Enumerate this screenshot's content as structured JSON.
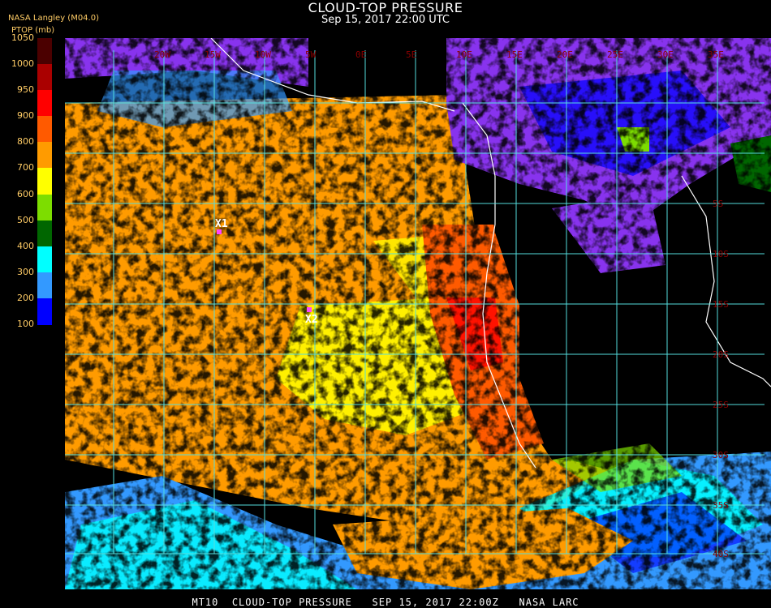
{
  "header": {
    "title": "CLOUD-TOP PRESSURE",
    "subtitle": "Sep 15, 2017 22:00 UTC",
    "source": "NASA Langley (M04.0)",
    "unit": "PTOP (mb)"
  },
  "legend": {
    "ticks": [
      "1050",
      "1000",
      "950",
      "900",
      "800",
      "700",
      "600",
      "500",
      "400",
      "300",
      "200",
      "100"
    ],
    "colors": [
      "#4b0000",
      "#aa0000",
      "#ff0000",
      "#ff5a00",
      "#ff9b00",
      "#ffff00",
      "#7ddd00",
      "#006600",
      "#00ffff",
      "#3399ff",
      "#0000ff",
      "#8833ee"
    ]
  },
  "map": {
    "lon_labels": [
      "20W",
      "15W",
      "10W",
      "5W",
      "0E",
      "5E",
      "10E",
      "15E",
      "20E",
      "25E",
      "30E",
      "35E"
    ],
    "lat_labels": [
      "5S",
      "10S",
      "15S",
      "20S",
      "25S",
      "30S",
      "35S",
      "40S"
    ],
    "markers": [
      {
        "label": "X1",
        "color": "#ff44ff"
      },
      {
        "label": "X2",
        "color": "#ff44ff"
      }
    ],
    "grid_color": "#55dddd"
  },
  "footer": {
    "text": "MT10  CLOUD-TOP PRESSURE   SEP 15, 2017 22:00Z   NASA LARC"
  }
}
